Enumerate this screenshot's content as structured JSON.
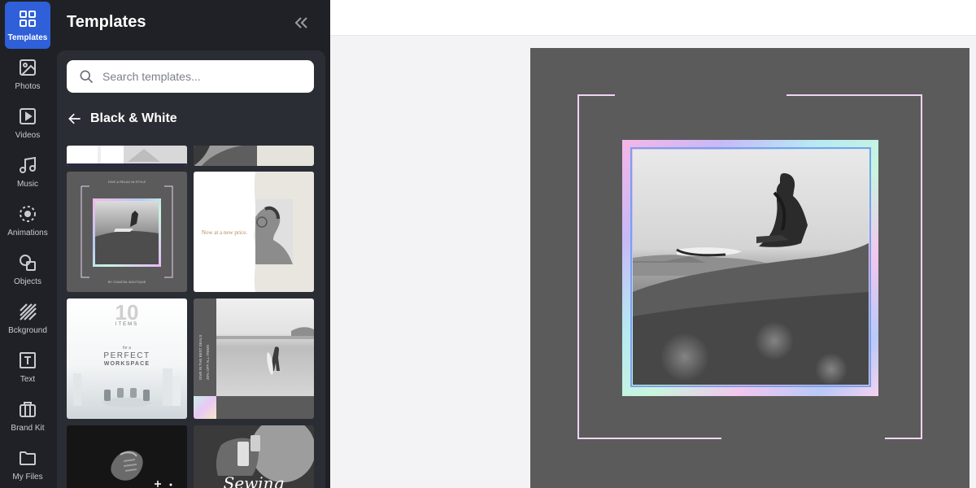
{
  "sidebar": {
    "items": [
      {
        "label": "Templates",
        "icon": "grid-icon"
      },
      {
        "label": "Photos",
        "icon": "image-icon"
      },
      {
        "label": "Videos",
        "icon": "play-icon"
      },
      {
        "label": "Music",
        "icon": "music-note-icon"
      },
      {
        "label": "Animations",
        "icon": "animation-icon"
      },
      {
        "label": "Objects",
        "icon": "shapes-icon"
      },
      {
        "label": "Bckground",
        "icon": "stripes-icon"
      },
      {
        "label": "Text",
        "icon": "text-icon"
      },
      {
        "label": "Brand Kit",
        "icon": "briefcase-icon"
      },
      {
        "label": "My Files",
        "icon": "folder-icon"
      }
    ],
    "active": "Templates"
  },
  "panel": {
    "title": "Templates",
    "collapse_icon": "double-chevron-left-icon",
    "search": {
      "placeholder": "Search templates...",
      "value": ""
    },
    "category": "Black & White",
    "thumbnails": {
      "t3_top": "DIVE & RELAX IN STYLE",
      "t3_bottom": "BY COASTAL BOUTIQUE",
      "t4_text": "Now at a new price.",
      "t5_number": "10",
      "t5_items": "ITEMS",
      "t5_fora": "for a",
      "t5_line1": "PERFECT",
      "t5_line2": "WORKSPACE",
      "t6_side": "DIVE IN THE BEST DEALS",
      "t6_side2": "20% OFF ALL ITEMS",
      "t8_script": "Sewing"
    }
  },
  "colors": {
    "accent": "#2f5fd9",
    "panel_bg": "#1f2126",
    "panel_body": "#2a2d33",
    "design_bg": "#5b5b5b",
    "frame_line": "#f0d4f4"
  }
}
